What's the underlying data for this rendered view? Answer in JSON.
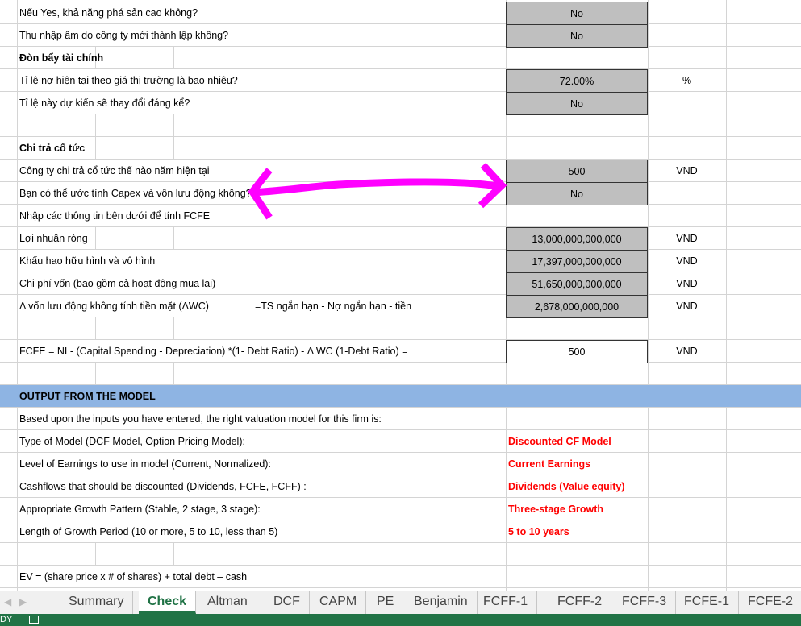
{
  "rows": [
    {
      "label": "Nếu Yes, khả năng phá sản cao không?",
      "value": "No",
      "value_style": "gray"
    },
    {
      "label": "Thu nhập âm do công ty mới thành lập không?",
      "value": "No",
      "value_style": "gray"
    },
    {
      "label": "Đòn bẩy tài chính",
      "bold": true,
      "grid": true
    },
    {
      "label": "Tỉ lệ nợ hiện tại theo giá thị trường là bao nhiêu?",
      "value": "72.00%",
      "value_style": "gray",
      "unit": "%"
    },
    {
      "label": "Tỉ lệ này dự kiến sẽ thay đổi đáng kể?",
      "value": "No",
      "value_style": "gray"
    },
    {
      "label": "",
      "grid": true
    },
    {
      "label": "Chi trả cổ tức",
      "bold": true,
      "grid": true
    },
    {
      "label": "Công ty chi trả cổ tức thế nào năm hiện tại",
      "value": "500",
      "value_style": "gray",
      "unit": "VND"
    },
    {
      "label": "Bạn có thể ước tính Capex và vốn lưu động không?",
      "value": "No",
      "value_style": "gray"
    },
    {
      "label": "Nhập các thông tin bên dưới để tính FCFE"
    },
    {
      "label": "Lợi nhuận ròng",
      "value": "13,000,000,000,000",
      "value_style": "gray",
      "unit": "VND",
      "grid": true
    },
    {
      "label": "Khấu hao hữu hình và vô hình",
      "value": "17,397,000,000,000",
      "value_style": "gray",
      "unit": "VND",
      "grid2": true
    },
    {
      "label": "Chi phí vốn (bao gồm cả hoạt động mua lại)",
      "value": "51,650,000,000,000",
      "value_style": "gray",
      "unit": "VND"
    },
    {
      "label": "Δ vốn lưu động không tính tiền mặt (ΔWC)",
      "note": "=TS ngắn hạn - Nợ ngắn hạn - tiền",
      "value": "2,678,000,000,000",
      "value_style": "gray",
      "unit": "VND"
    },
    {
      "label": "",
      "grid": true
    },
    {
      "label": "FCFE = NI - (Capital Spending - Depreciation) *(1- Debt Ratio) - Δ WC (1-Debt Ratio) =",
      "value": "500",
      "value_style": "box",
      "unit": "VND"
    },
    {
      "label": "",
      "grid": true
    },
    {
      "label": "OUTPUT FROM THE MODEL",
      "band": true
    },
    {
      "label": "Based upon the inputs you have entered, the right valuation model for this firm is:"
    },
    {
      "label": "Type of Model (DCF Model, Option Pricing Model):",
      "result": "Discounted CF Model"
    },
    {
      "label": "Level of Earnings to use in model (Current, Normalized):",
      "result": "Current Earnings"
    },
    {
      "label": "Cashflows that should be discounted (Dividends, FCFE, FCFF) :",
      "result": "Dividends (Value equity)"
    },
    {
      "label": "Appropriate Growth Pattern (Stable, 2 stage,  3 stage):",
      "result": "Three-stage Growth"
    },
    {
      "label": "Length of Growth Period (10 or more, 5 to 10, less than 5)",
      "result": "5 to 10 years"
    },
    {
      "label": "",
      "grid": true
    },
    {
      "label": "EV = (share price x # of shares) + total debt – cash"
    }
  ],
  "tabs": [
    "Summary",
    "Check",
    "Altman",
    "DCF",
    "CAPM",
    "PE",
    "Benjamin",
    "FCFF-1",
    "FCFF-2",
    "FCFF-3",
    "FCFE-1",
    "FCFE-2"
  ],
  "active_tab": "Check",
  "status": {
    "text": "DY"
  },
  "colors": {
    "band": "#8eb4e3",
    "result": "#ff0000",
    "excel_green": "#217346",
    "annotation": "#ff00ff"
  }
}
